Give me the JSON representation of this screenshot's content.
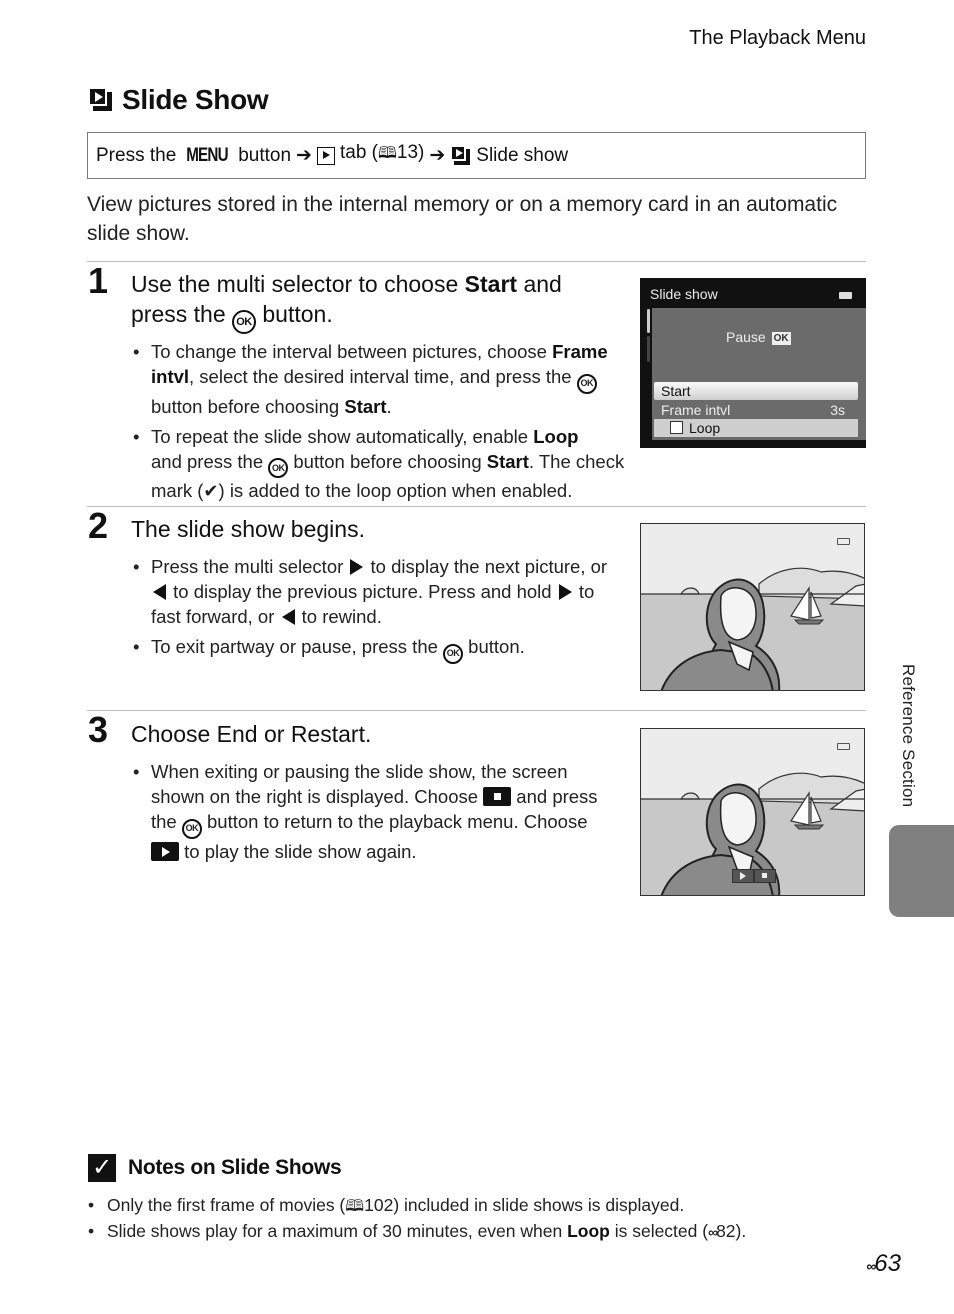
{
  "running_head": "The Playback Menu",
  "title": {
    "icon": "slide-show-icon",
    "text": "Slide Show"
  },
  "menu_path": {
    "press": "Press the",
    "menu_word": "MENU",
    "button": "button",
    "arrow": "➔",
    "tab": "tab (",
    "book_glyph": "🕮",
    "tab_ref": "13)",
    "item": "Slide show"
  },
  "intro": "View pictures stored in the internal memory or on a memory card in an automatic slide show.",
  "steps": [
    {
      "number": "1",
      "heading_pre": "Use the multi selector to choose ",
      "heading_bold": "Start",
      "heading_mid": " and press the ",
      "heading_post": " button.",
      "bullets": [
        {
          "a": "To change the interval between pictures, choose ",
          "b1": "Frame intvl",
          "c": ", select the desired interval time, and press the ",
          "d": " button before choosing ",
          "b2": "Start",
          "e": "."
        },
        {
          "a": "To repeat the slide show automatically, enable ",
          "b1": "Loop",
          "c": " and press the ",
          "d": " button before choosing ",
          "b2": "Start",
          "e": ". The check mark (",
          "check": "✔",
          "f": ") is added to the loop option when enabled."
        }
      ]
    },
    {
      "number": "2",
      "heading": "The slide show begins.",
      "bullets": [
        {
          "a": "Press the multi selector ",
          "b": " to display the next picture, or ",
          "c": " to display the previous picture. Press and hold ",
          "d": " to fast forward, or ",
          "e": " to rewind."
        },
        {
          "a": "To exit partway or pause, press the ",
          "b": " button."
        }
      ]
    },
    {
      "number": "3",
      "heading": "Choose End or Restart.",
      "bullets": [
        {
          "a": "When exiting or pausing the slide show, the screen shown on the right is displayed. Choose ",
          "b": " and press the ",
          "c": " button to return to the playback menu. Choose ",
          "d": " to play the slide show again."
        }
      ]
    }
  ],
  "ok_label": "OK",
  "camera_menu": {
    "header": "Slide show",
    "pause_label": "Pause",
    "pause_ok": "OK",
    "items": [
      {
        "label": "Start",
        "selected": true
      },
      {
        "label": "Frame intvl",
        "value": "3s"
      },
      {
        "label": "Loop",
        "checked": false
      }
    ]
  },
  "notes": {
    "heading": "Notes on Slide Shows",
    "check_glyph": "✓",
    "items": [
      {
        "a": "Only the first frame of movies (",
        "book": "🕮",
        "ref": "102) included in slide shows is displayed."
      },
      {
        "a": "Slide shows play for a maximum of 30 minutes, even when ",
        "bold": "Loop",
        "b": " is selected (",
        "binoc": "∞",
        "ref": "82)."
      }
    ]
  },
  "side_tab": "Reference Section",
  "page_number": {
    "prefix": "∞",
    "number": "63"
  }
}
